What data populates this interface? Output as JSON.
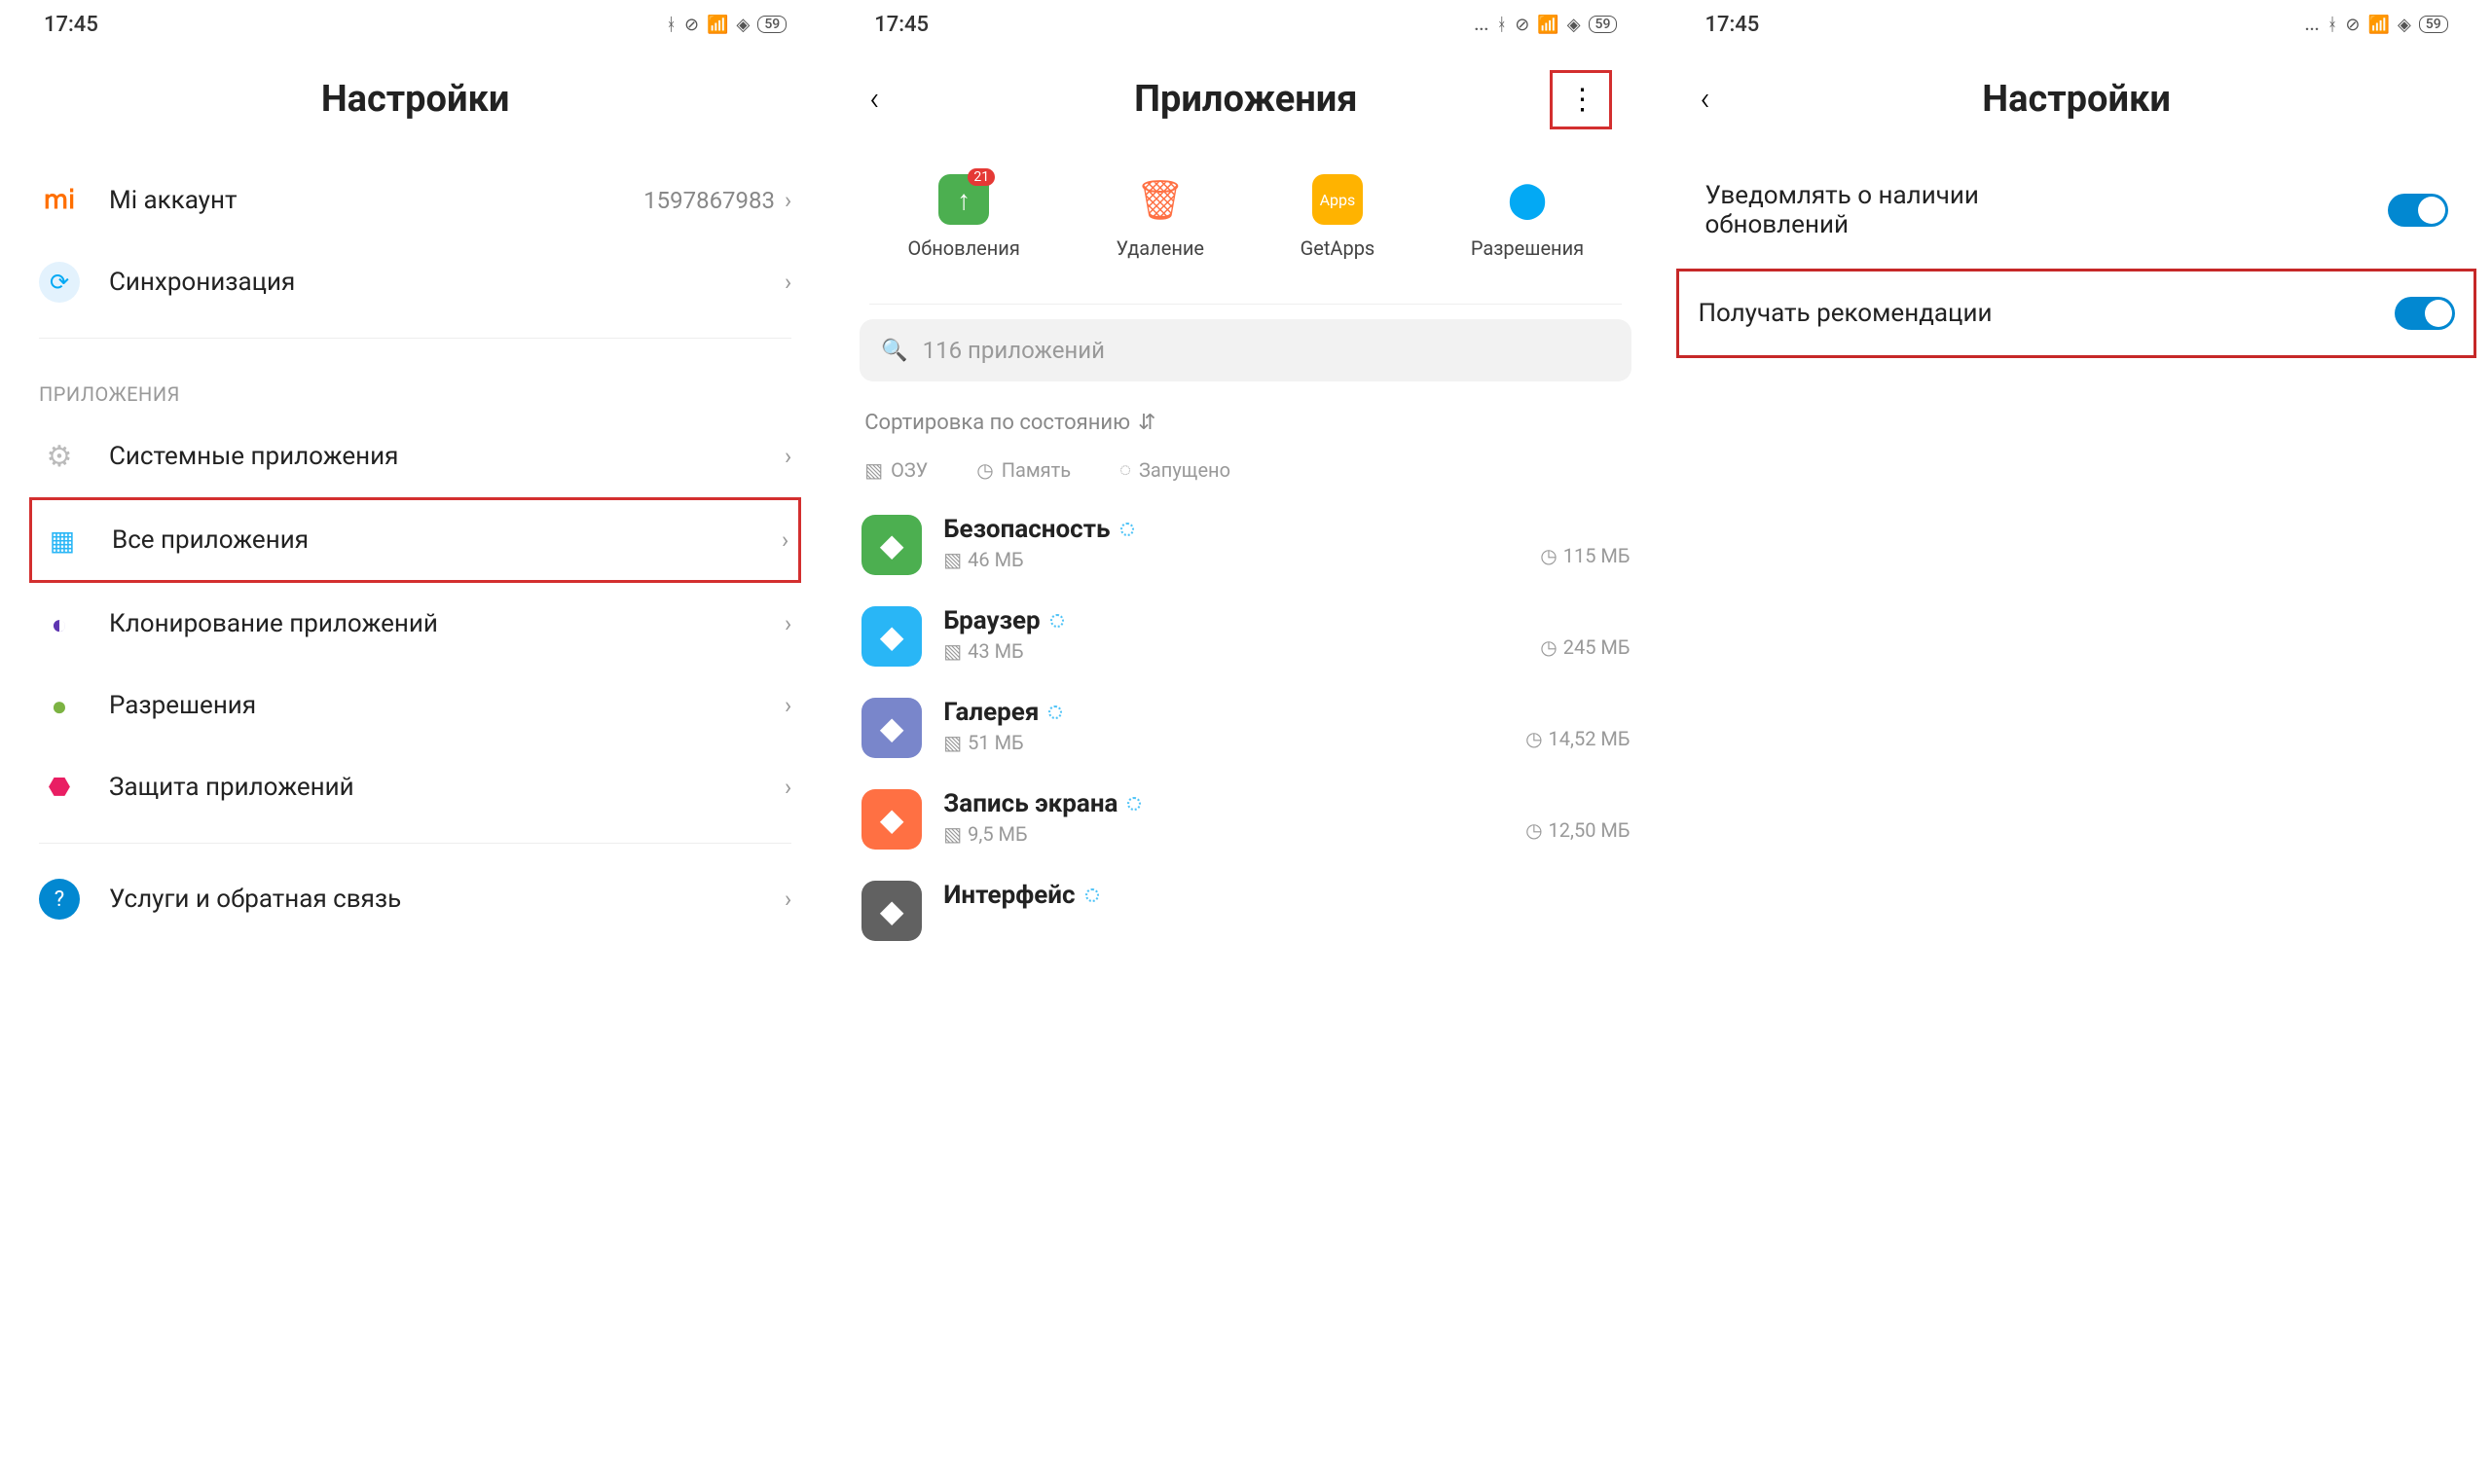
{
  "status": {
    "time": "17:45",
    "battery": "59"
  },
  "pane1": {
    "title": "Настройки",
    "account": {
      "label": "Mi аккаунт",
      "value": "1597867983"
    },
    "sync": "Синхронизация",
    "section": "ПРИЛОЖЕНИЯ",
    "items": {
      "system": "Системные приложения",
      "all": "Все приложения",
      "clone": "Клонирование приложений",
      "perm": "Разрешения",
      "protect": "Защита приложений"
    },
    "services": "Услуги и обратная связь"
  },
  "pane2": {
    "title": "Приложения",
    "actions": {
      "updates": {
        "label": "Обновления",
        "badge": "21"
      },
      "delete": "Удаление",
      "getapps": "GetApps",
      "perm": "Разрешения"
    },
    "search": "116 приложений",
    "sort": "Сортировка по состоянию",
    "filters": {
      "ram": "ОЗУ",
      "storage": "Память",
      "running": "Запущено"
    },
    "apps": [
      {
        "name": "Безопасность",
        "ram": "46 МБ",
        "storage": "115 МБ",
        "bg": "#4caf50"
      },
      {
        "name": "Браузер",
        "ram": "43 МБ",
        "storage": "245 МБ",
        "bg": "#29b6f6"
      },
      {
        "name": "Галерея",
        "ram": "51 МБ",
        "storage": "14,52 МБ",
        "bg": "#7986cb"
      },
      {
        "name": "Запись экрана",
        "ram": "9,5 МБ",
        "storage": "12,50 МБ",
        "bg": "#ff7043"
      },
      {
        "name": "Интерфейс",
        "ram": "",
        "storage": "",
        "bg": "#616161"
      }
    ]
  },
  "pane3": {
    "title": "Настройки",
    "notify": "Уведомлять о наличии обновлений",
    "recommend": "Получать рекомендации"
  }
}
